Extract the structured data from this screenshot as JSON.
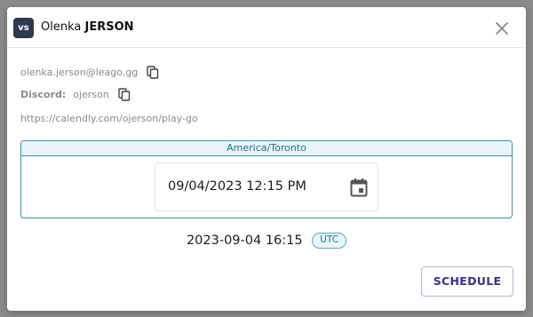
{
  "dialog": {
    "avatar_text": "vs",
    "first_name": "Olenka",
    "last_name": "JERSON"
  },
  "contact": {
    "email": "olenka.jerson@leago.gg",
    "discord_label": "Discord:",
    "discord_value": "ojerson",
    "calendly_url": "https://calendly.com/ojerson/play-go"
  },
  "timezone": {
    "name": "America/Toronto",
    "datetime_value": "09/04/2023 12:15 PM"
  },
  "utc": {
    "datetime": "2023-09-04 16:15",
    "badge": "UTC"
  },
  "actions": {
    "schedule_label": "SCHEDULE"
  },
  "colors": {
    "accent_blue": "#3a8fb0",
    "button_text": "#3b2f8c",
    "avatar_bg": "#2e3a4e"
  },
  "icons": {
    "close": "close-icon",
    "copy": "copy-icon",
    "calendar": "calendar-icon"
  }
}
